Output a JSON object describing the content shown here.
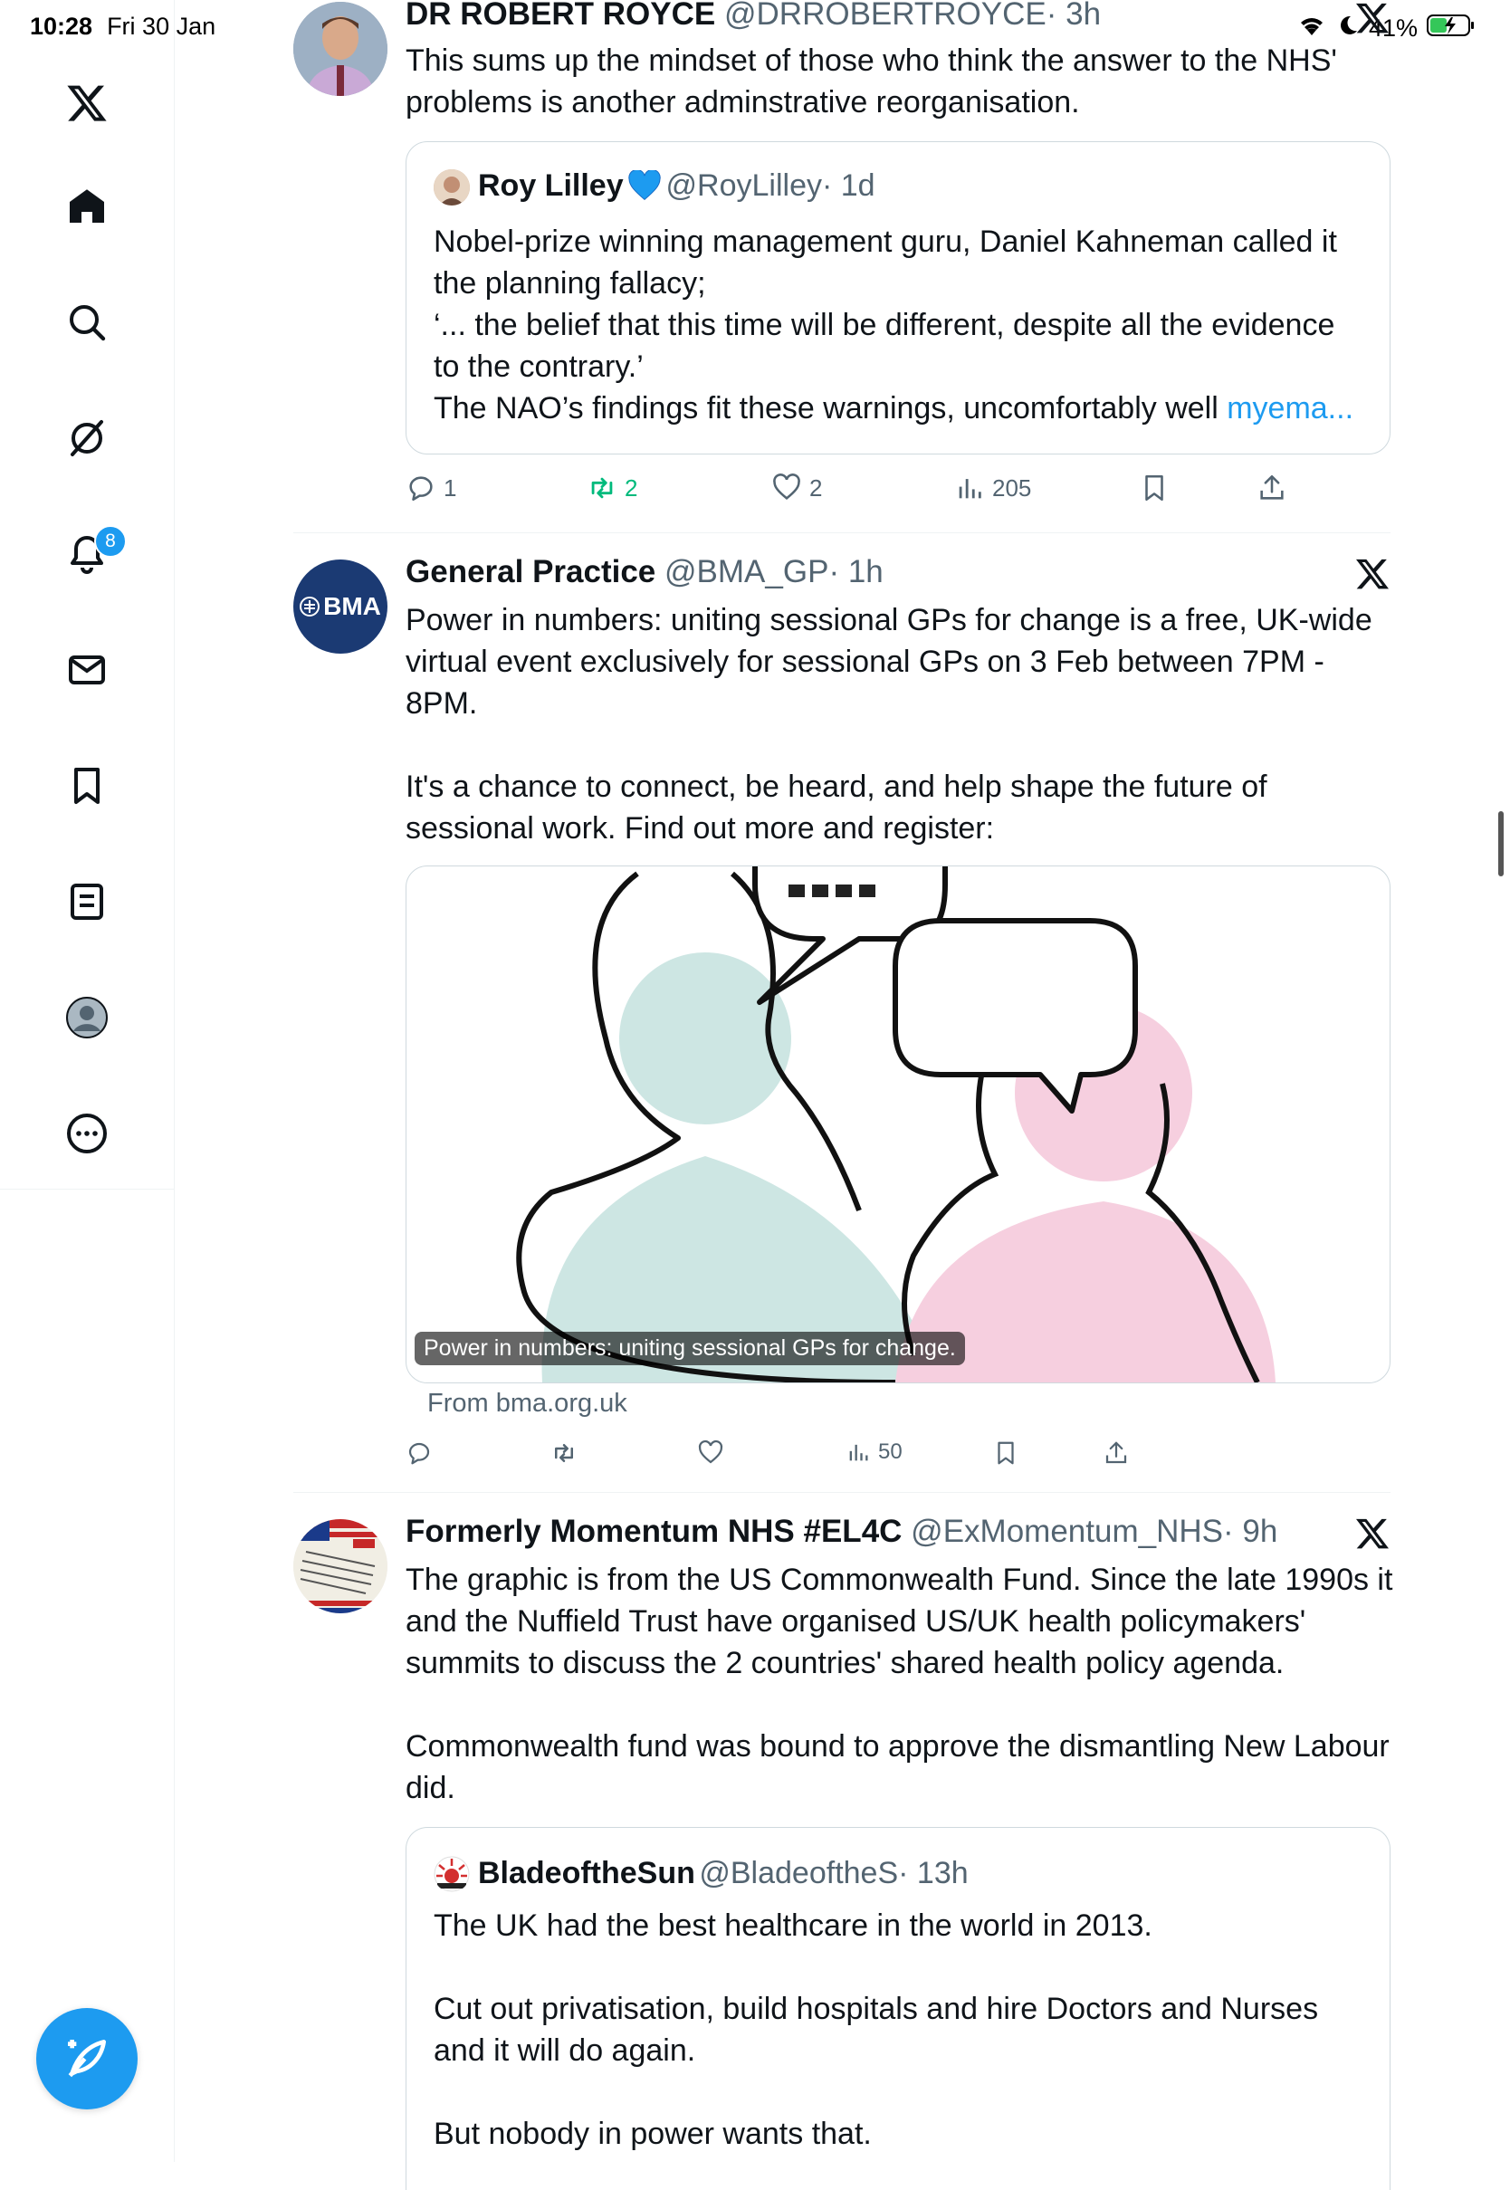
{
  "status_bar": {
    "time": "10:28",
    "date": "Fri 30 Jan",
    "battery": "41%"
  },
  "sidebar": {
    "notifications_badge": "8",
    "items": [
      "home",
      "search",
      "grok",
      "notifications",
      "messages",
      "bookmarks",
      "lists",
      "profile",
      "more"
    ]
  },
  "tweets": [
    {
      "name": "DR ROBERT ROYCE",
      "handle": "@DRROBERTROYCE",
      "time": "· 3h",
      "text": "This sums up the mindset of those who think the answer to the NHS' problems is another adminstrative reorganisation.",
      "quote": {
        "name": "Roy Lilley",
        "verified_icon": "blue-heart",
        "handle": "@RoyLilley",
        "time": "· 1d",
        "text_main": "Nobel-prize winning management guru, Daniel Kahneman called it the planning fallacy;\n‘... the belief that this time will be different, despite all the evidence to the contrary.’\nThe NAO’s findings fit these warnings, uncomfortably well ",
        "link": "myema..."
      },
      "actions": {
        "replies": "1",
        "reposts": "2",
        "likes": "2",
        "views": "205"
      },
      "repost_color": "#00ba7c"
    },
    {
      "name": "General Practice",
      "handle": "@BMA_GP",
      "time": "· 1h",
      "avatar_text": "BMA",
      "text": "Power in numbers: uniting sessional GPs for change is a free, UK-wide virtual event exclusively for sessional GPs on 3 Feb between 7PM - 8PM.\n\nIt's a chance to connect, be heard, and help shape the future of sessional work. Find out more and register:",
      "card": {
        "caption": "Power in numbers: uniting sessional GPs for change.",
        "from": "From bma.org.uk"
      },
      "actions": {
        "views": "50"
      }
    },
    {
      "name": "Formerly Momentum NHS #EL4C",
      "handle": "@ExMomentum_NHS",
      "time": "· 9h",
      "text": "The graphic is from the US Commonwealth Fund. Since the late 1990s it and the Nuffield Trust have organised US/UK health policymakers' summits to discuss the 2 countries' shared health policy agenda.\n\nCommonwealth fund was bound to approve the dismantling New Labour did.",
      "quote": {
        "name": "BladeoftheSun",
        "handle": "@BladeoftheS",
        "time": "· 13h",
        "text": "The UK had the best healthcare in the world in 2013.\n\nCut out privatisation, build hospitals and hire Doctors and Nurses and it will do again.\n\nBut nobody in power wants that."
      }
    }
  ]
}
